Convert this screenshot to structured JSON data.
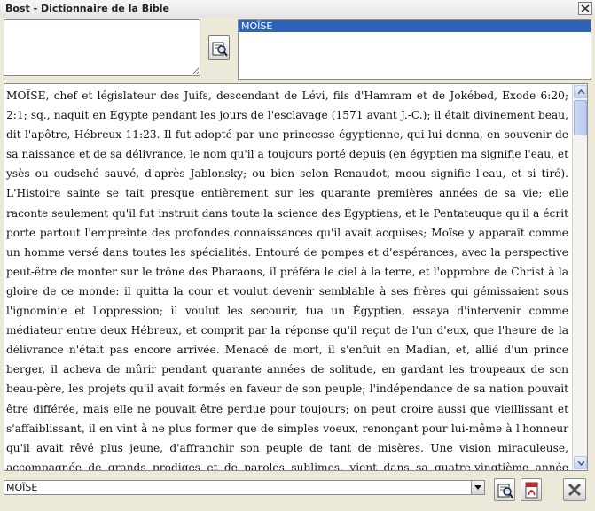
{
  "window": {
    "title": "Bost - Dictionnaire de la Bible"
  },
  "search": {
    "query": "",
    "button_icon": "search-book-icon"
  },
  "results": {
    "items": [
      "MOÏSE"
    ],
    "selected_index": 0
  },
  "article": {
    "text": "MOÏSE, chef et législateur des Juifs, descendant de Lévi, fils d'Hamram et de Jokébed, Exode 6:20; 2:1; sq., naquit en Égypte pendant les jours de l'esclavage (1571 avant J.-C.); il était divinement beau, dit l'apôtre, Hébreux 11:23. Il fut adopté par une princesse égyptienne, qui lui donna, en souvenir de sa naissance et de sa délivrance, le nom qu'il a toujours porté depuis (en égyptien ma signifie l'eau, et ysès ou oudsché sauvé, d'après Jablonsky; ou bien selon Renaudot, moou signifie l'eau, et si tiré). L'Histoire sainte se tait presque entièrement sur les quarante premières années de sa vie; elle raconte seulement qu'il fut instruit dans toute la science des Égyptiens, et le Pentateuque qu'il a écrit porte partout l'empreinte des profondes connaissances qu'il avait acquises; Moïse y apparaît comme un homme versé dans toutes les spécialités. Entouré de pompes et d'espérances, avec la perspective peut-être de monter sur le trône des Pharaons, il préféra le ciel à la terre, et l'opprobre de Christ à la gloire de ce monde: il quitta la cour et voulut devenir semblable à ses frères qui gémissaient sous l'ignominie et l'oppression; il voulut les secourir, tua un Égyptien, essaya d'intervenir comme médiateur entre deux Hébreux, et comprit par la réponse qu'il reçut de l'un d'eux, que l'heure de la délivrance n'était pas encore arrivée. Menacé de mort, il s'enfuit en Madian, et, allié d'un prince berger, il acheva de mûrir pendant quarante années de solitude, en gardant les troupeaux de son beau-père, les projets qu'il avait formés en faveur de son peuple; l'indépendance de sa nation pouvait être différée, mais elle ne pouvait être perdue pour toujours; on peut croire aussi que vieillissant et s'affaiblissant, il en vint à ne plus former que de simples voeux, renonçant pour lui-même à l'honneur qu'il avait rêvé plus jeune, d'affranchir son peuple de tant de misères. Une vision miraculeuse, accompagnée de grands prodiges et de paroles sublimes, vient dans sa quatre-vingtième année l'arracher aux travaux paisibles dont il avait pris l'habitude, et faire d'un conducteur de brebis un conducteur d'hommes vivants. Faible, craintif"
  },
  "bottom": {
    "combo_value": "MOÏSE",
    "search_icon": "search-book-icon",
    "pdf_icon": "pdf-icon",
    "close_icon": "close-icon"
  },
  "colors": {
    "selection": "#2e63b8",
    "background": "#ece9d8"
  }
}
